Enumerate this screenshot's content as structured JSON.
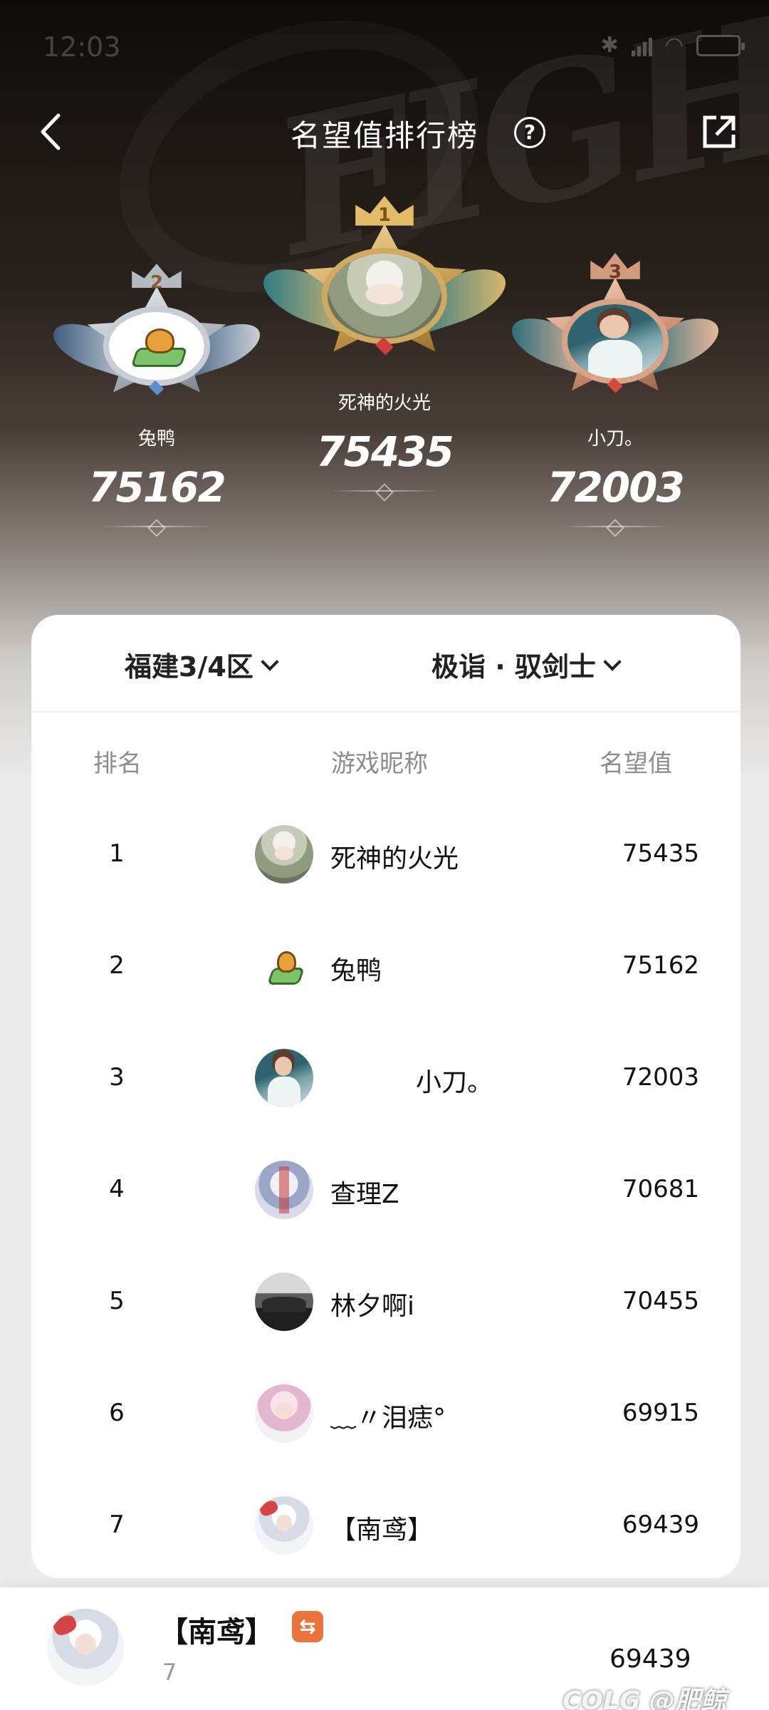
{
  "status": {
    "time": "12:03"
  },
  "header": {
    "title": "名望值排行榜",
    "help": "?"
  },
  "podium": [
    {
      "rank": "2",
      "name": "兔鸭",
      "score": "75162"
    },
    {
      "rank": "1",
      "name": "死神的火光",
      "score": "75435"
    },
    {
      "rank": "3",
      "name": "小刀。",
      "score": "72003"
    }
  ],
  "filters": {
    "region": "福建3/4区",
    "class": "极诣 · 驭剑士"
  },
  "table": {
    "headers": {
      "rank": "排名",
      "name": "游戏昵称",
      "score": "名望值"
    },
    "rows": [
      {
        "rank": "1",
        "name": "死神的火光",
        "score": "75435"
      },
      {
        "rank": "2",
        "name": "兔鸭",
        "score": "75162"
      },
      {
        "rank": "3",
        "name": "小刀。",
        "score": "72003"
      },
      {
        "rank": "4",
        "name": "查理Z",
        "score": "70681"
      },
      {
        "rank": "5",
        "name": "林夕啊i",
        "score": "70455"
      },
      {
        "rank": "6",
        "name": "﹏〃泪痣°",
        "score": "69915"
      },
      {
        "rank": "7",
        "name": "【南鸢】",
        "score": "69439"
      }
    ]
  },
  "me": {
    "name": "【南鸢】",
    "tag": "⇆",
    "rank": "7",
    "score": "69439"
  },
  "watermark": "COLG @肥鲸"
}
